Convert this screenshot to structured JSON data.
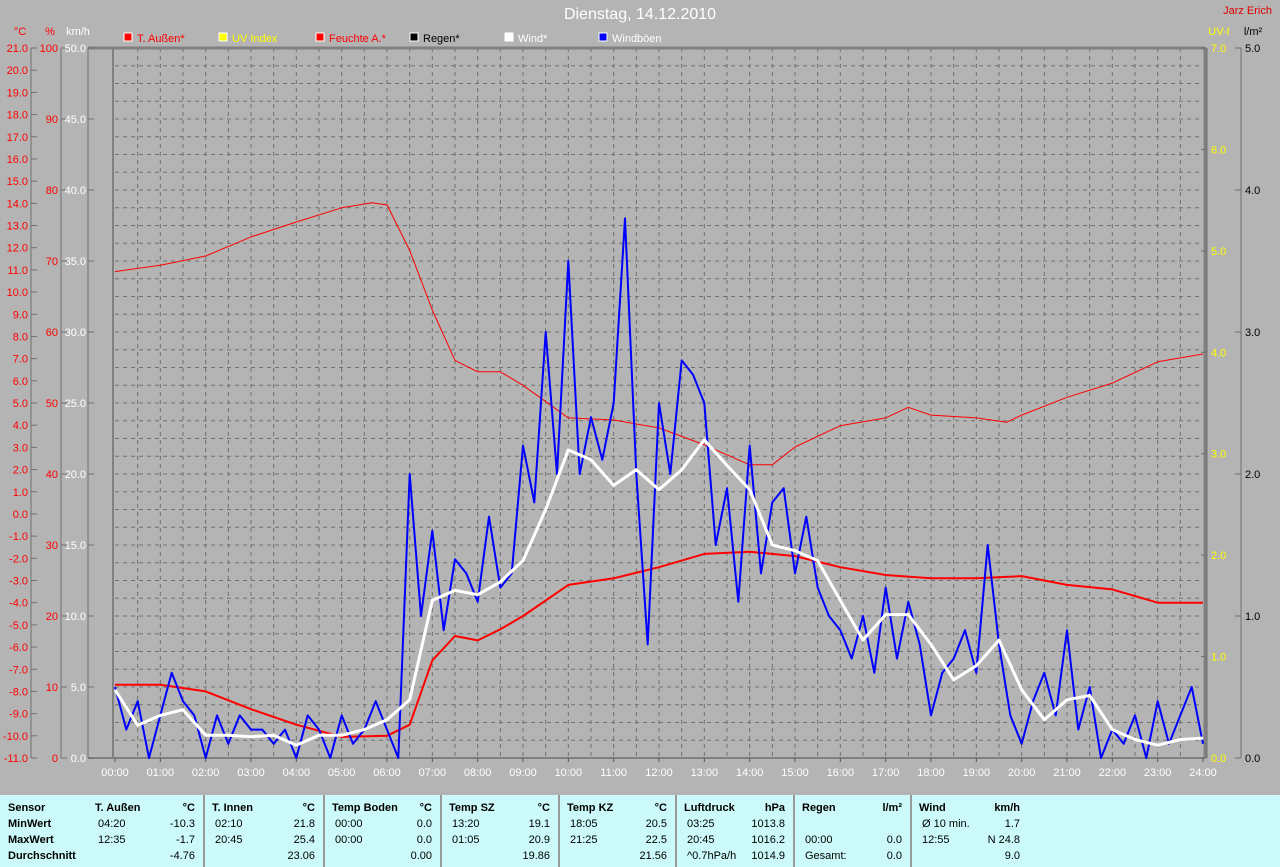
{
  "header": {
    "title": "Dienstag, 14.12.2010",
    "author": "Jarz Erich"
  },
  "legend": [
    {
      "label": "T. Außen*",
      "color": "#ff0000",
      "text_color": "#ff0000"
    },
    {
      "label": "UV Index",
      "color": "#ffff00",
      "text_color": "#ffff00"
    },
    {
      "label": "Feuchte A.*",
      "color": "#ff0000",
      "text_color": "#ff0000"
    },
    {
      "label": "Regen*",
      "color": "#000000",
      "text_color": "#000000"
    },
    {
      "label": "Wind*",
      "color": "#ffffff",
      "text_color": "#ffffff"
    },
    {
      "label": "Windböen",
      "color": "#0000ff",
      "text_color": "#ffffff"
    }
  ],
  "chart_data": {
    "type": "line",
    "x_unit": "hours",
    "xlim": [
      0,
      24
    ],
    "x_ticks": [
      "00:00",
      "01:00",
      "02:00",
      "03:00",
      "04:00",
      "05:00",
      "06:00",
      "07:00",
      "08:00",
      "09:00",
      "10:00",
      "11:00",
      "12:00",
      "13:00",
      "14:00",
      "15:00",
      "16:00",
      "17:00",
      "18:00",
      "19:00",
      "20:00",
      "21:00",
      "22:00",
      "23:00",
      "24:00"
    ],
    "axes": {
      "temp": {
        "unit": "°C",
        "range": [
          -11,
          21
        ],
        "step": 1
      },
      "humidity": {
        "unit": "%",
        "range": [
          0,
          100
        ],
        "step": 10
      },
      "wind": {
        "unit": "km/h",
        "range": [
          0,
          50
        ],
        "step": 5
      },
      "uv": {
        "unit": "UV-I",
        "range": [
          0,
          7
        ],
        "step": 1
      },
      "rain": {
        "unit": "l/m²",
        "range": [
          0,
          5
        ],
        "step": 1
      }
    },
    "series": [
      {
        "name": "T. Außen*",
        "axis": "temp",
        "color": "#ff0000",
        "width": 2,
        "x": [
          0,
          1,
          2,
          3,
          4,
          5,
          6,
          6.5,
          7,
          7.5,
          8,
          8.5,
          9,
          9.5,
          10,
          11,
          12,
          13,
          14,
          15,
          16,
          17,
          18,
          19,
          20,
          21,
          22,
          23,
          24
        ],
        "y": [
          -7.7,
          -7.7,
          -8.0,
          -8.8,
          -9.5,
          -10.05,
          -10.0,
          -9.5,
          -6.6,
          -5.5,
          -5.7,
          -5.2,
          -4.6,
          -3.9,
          -3.2,
          -2.9,
          -2.4,
          -1.8,
          -1.7,
          -1.9,
          -2.4,
          -2.75,
          -2.9,
          -2.9,
          -2.8,
          -3.2,
          -3.4,
          -4.0,
          -4.0
        ]
      },
      {
        "name": "Feuchte A.*",
        "axis": "humidity",
        "color": "#ff0000",
        "width": 1,
        "x": [
          0,
          1,
          2,
          3,
          4,
          5,
          5.67,
          6,
          6.5,
          7,
          7.5,
          8,
          8.5,
          9,
          10,
          11,
          12,
          13,
          14,
          14.5,
          15,
          16,
          17,
          17.5,
          18,
          19,
          19.67,
          20,
          21,
          22,
          23,
          24
        ],
        "y": [
          68.5,
          69.4,
          70.7,
          73.4,
          75.5,
          77.5,
          78.2,
          77.9,
          71.5,
          63.1,
          56,
          54.4,
          54.4,
          52.5,
          47.9,
          47.6,
          46.5,
          44.1,
          41.3,
          41.3,
          43.8,
          46.8,
          47.9,
          49.4,
          48.3,
          47.9,
          47.3,
          48.3,
          50.8,
          52.8,
          55.8,
          56.9
        ]
      },
      {
        "name": "Windböen",
        "axis": "wind",
        "color": "#0000ff",
        "width": 2,
        "x_step": 0.25,
        "y": [
          5,
          2,
          4,
          0,
          3,
          6,
          4,
          3,
          0,
          3,
          1,
          3,
          2,
          2,
          1,
          2,
          0,
          3,
          2,
          0,
          3,
          1,
          2,
          4,
          2,
          0,
          20,
          10,
          16,
          9,
          14,
          13,
          11,
          17,
          12,
          13,
          22,
          18,
          30,
          20,
          35,
          20,
          24,
          21,
          25,
          38,
          20,
          8,
          25,
          20,
          28,
          27,
          25,
          15,
          19,
          11,
          22,
          13,
          18,
          19,
          13,
          17,
          12,
          10,
          9,
          7,
          10,
          6,
          12,
          7,
          11,
          8,
          3,
          6,
          7,
          9,
          6,
          15,
          8,
          3,
          1,
          4,
          6,
          3,
          9,
          2,
          5,
          0,
          2,
          1,
          3,
          0,
          4,
          1,
          3,
          5,
          1
        ]
      },
      {
        "name": "Wind*",
        "axis": "wind",
        "color": "#ffffff",
        "width": 3,
        "x_step": 0.5,
        "y": [
          4.8,
          2.3,
          3.0,
          3.4,
          1.6,
          1.6,
          1.5,
          1.6,
          0.9,
          1.6,
          1.6,
          2.0,
          2.7,
          4.1,
          11.1,
          11.8,
          11.5,
          12.4,
          13.9,
          17.5,
          21.7,
          21.0,
          19.2,
          20.3,
          18.9,
          20.3,
          22.4,
          20.6,
          18.9,
          15.0,
          14.6,
          13.9,
          11.1,
          8.3,
          10.1,
          10.1,
          8.0,
          5.5,
          6.5,
          8.3,
          4.8,
          2.7,
          4.1,
          4.4,
          2.0,
          1.3,
          0.9,
          1.3,
          1.4
        ]
      }
    ]
  },
  "stats": {
    "columns": [
      {
        "title": "Sensor",
        "unit": "",
        "rows": [
          [
            "MinWert",
            "",
            ""
          ],
          [
            "MaxWert",
            "",
            ""
          ],
          [
            "Durchschnitt",
            "",
            ""
          ]
        ]
      },
      {
        "title": "T. Außen",
        "unit": "°C",
        "rows": [
          [
            "04:20",
            "-10.3"
          ],
          [
            "12:35",
            "-1.7"
          ],
          [
            "",
            "-4.76"
          ]
        ]
      },
      {
        "title": "T. Innen",
        "unit": "°C",
        "rows": [
          [
            "02:10",
            "21.8"
          ],
          [
            "20:45",
            "25.4"
          ],
          [
            "",
            "23.06"
          ]
        ]
      },
      {
        "title": "Temp Boden",
        "unit": "°C",
        "rows": [
          [
            "00:00",
            "0.0"
          ],
          [
            "00:00",
            "0.0"
          ],
          [
            "",
            "0.00"
          ]
        ]
      },
      {
        "title": "Temp SZ",
        "unit": "°C",
        "rows": [
          [
            "13:20",
            "19.1"
          ],
          [
            "01:05",
            "20.9"
          ],
          [
            "",
            "19.86"
          ]
        ]
      },
      {
        "title": "Temp KZ",
        "unit": "°C",
        "rows": [
          [
            "18:05",
            "20.5"
          ],
          [
            "21:25",
            "22.5"
          ],
          [
            "",
            "21.56"
          ]
        ]
      },
      {
        "title": "Luftdruck",
        "unit": "hPa",
        "rows": [
          [
            "03:25",
            "1013.8"
          ],
          [
            "20:45",
            "1016.2"
          ],
          [
            "^0.7hPa/h",
            "1014.9"
          ]
        ]
      },
      {
        "title": "Regen",
        "unit": "l/m²",
        "rows": [
          [
            "",
            ""
          ],
          [
            "00:00",
            "0.0"
          ],
          [
            "Gesamt:",
            "0.0"
          ]
        ]
      },
      {
        "title": "Wind",
        "unit": "km/h",
        "rows": [
          [
            "Ø 10 min.",
            "1.7"
          ],
          [
            "12:55",
            "N 24.8"
          ],
          [
            "",
            "9.0"
          ]
        ]
      }
    ]
  }
}
